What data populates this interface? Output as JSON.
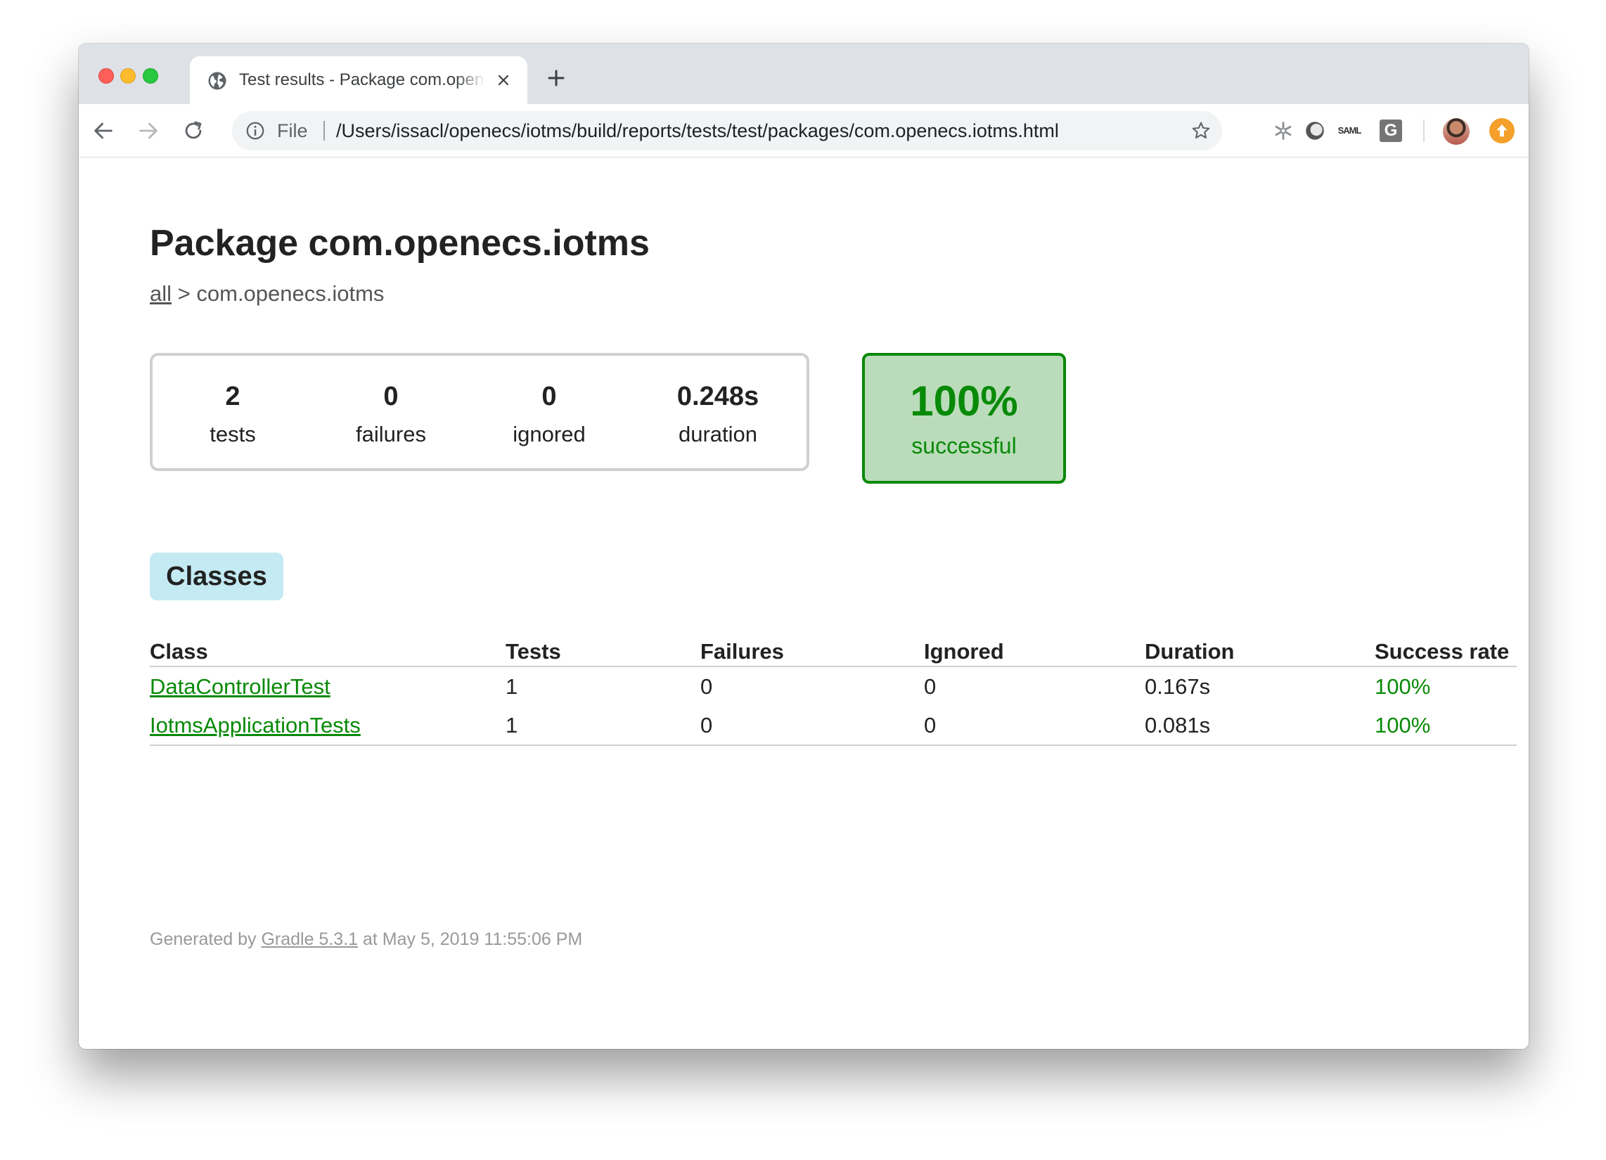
{
  "browser": {
    "tab_title": "Test results - Package com.openecs.iotms",
    "omnibox": {
      "scheme_label": "File",
      "url": "/Users/issacl/openecs/iotms/build/reports/tests/test/packages/com.openecs.iotms.html"
    },
    "extensions": [
      {
        "name": "snowflake-extension-icon"
      },
      {
        "name": "circle-extension-icon"
      },
      {
        "name": "saml-extension-icon",
        "text": "SAML"
      },
      {
        "name": "g-extension-icon",
        "text": "G"
      }
    ]
  },
  "page": {
    "title": "Package com.openecs.iotms",
    "breadcrumb": {
      "root_link": "all",
      "separator": ">",
      "current": "com.openecs.iotms"
    },
    "summary": {
      "tests": {
        "value": "2",
        "label": "tests"
      },
      "failures": {
        "value": "0",
        "label": "failures"
      },
      "ignored": {
        "value": "0",
        "label": "ignored"
      },
      "duration": {
        "value": "0.248s",
        "label": "duration"
      }
    },
    "success": {
      "value": "100%",
      "label": "successful"
    },
    "tab_label": "Classes",
    "table": {
      "headers": [
        "Class",
        "Tests",
        "Failures",
        "Ignored",
        "Duration",
        "Success rate"
      ],
      "rows": [
        [
          "DataControllerTest",
          "1",
          "0",
          "0",
          "0.167s",
          "100%"
        ],
        [
          "IotmsApplicationTests",
          "1",
          "0",
          "0",
          "0.081s",
          "100%"
        ]
      ]
    },
    "footer": {
      "prefix": "Generated by",
      "link": "Gradle 5.3.1",
      "suffix": "at May 5, 2019 11:55:06 PM"
    }
  },
  "colors": {
    "success_green": "#088a08",
    "success_bg": "#bbdcbb",
    "tab_chip_bg": "#c4eaf3",
    "update_orange": "#f4a02b"
  }
}
